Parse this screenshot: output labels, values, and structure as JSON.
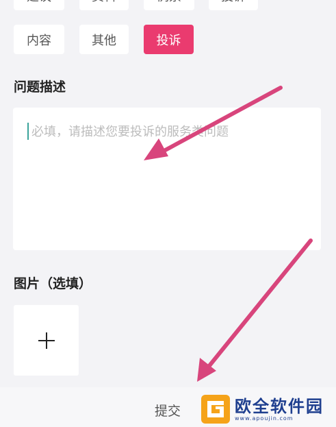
{
  "categories_partial": [
    "建议",
    "资料",
    "例票",
    "投诉"
  ],
  "categories": [
    {
      "label": "内容",
      "selected": false
    },
    {
      "label": "其他",
      "selected": false
    },
    {
      "label": "投诉",
      "selected": true
    }
  ],
  "description": {
    "title": "问题描述",
    "placeholder": "必填，请描述您要投诉的服务类问题"
  },
  "images": {
    "title": "图片（选填）",
    "add_symbol": "+"
  },
  "footer": {
    "submit_label": "提交"
  },
  "watermark": {
    "text": "欧全软件园",
    "url": "www.apoujin.com"
  },
  "colors": {
    "accent": "#ea3b6f",
    "arrow": "#d8457c",
    "background": "#f3f3f6"
  }
}
